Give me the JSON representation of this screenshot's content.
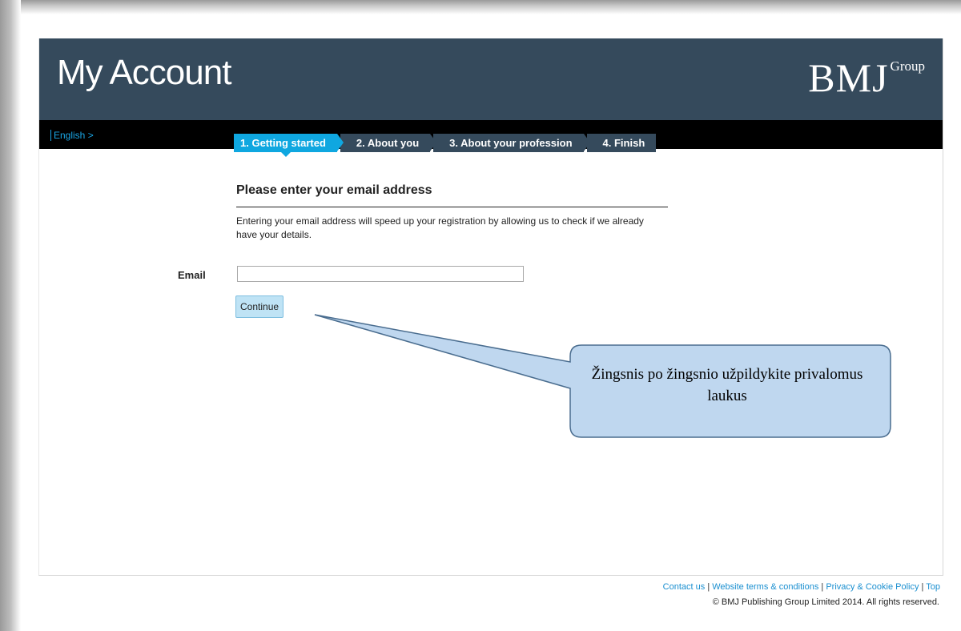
{
  "header": {
    "title": "My Account",
    "logo_main": "BMJ",
    "logo_sup": "Group"
  },
  "language": {
    "link": "English >"
  },
  "steps": [
    {
      "label": "1. Getting started",
      "active": true
    },
    {
      "label": "2. About you",
      "active": false
    },
    {
      "label": "3. About your profession",
      "active": false
    },
    {
      "label": "4. Finish",
      "active": false
    }
  ],
  "form": {
    "heading": "Please enter your email address",
    "help_text": "Entering your email address will speed up your registration by allowing us to check if we already have your details.",
    "email_label": "Email",
    "email_value": "",
    "continue_label": "Continue"
  },
  "callout": {
    "text": "Žingsnis po žingsnio užpildykite privalomus laukus",
    "fill": "#bfd7ef",
    "stroke": "#4a6d8f"
  },
  "footer": {
    "links": [
      "Contact us",
      "Website terms & conditions",
      "Privacy & Cookie Policy",
      "Top"
    ],
    "separator": "|",
    "copyright": "© BMJ Publishing Group Limited 2014. All rights reserved."
  },
  "colors": {
    "header_bg": "#354a5c",
    "active_step": "#0fa7e0",
    "link": "#1a8fd0"
  }
}
